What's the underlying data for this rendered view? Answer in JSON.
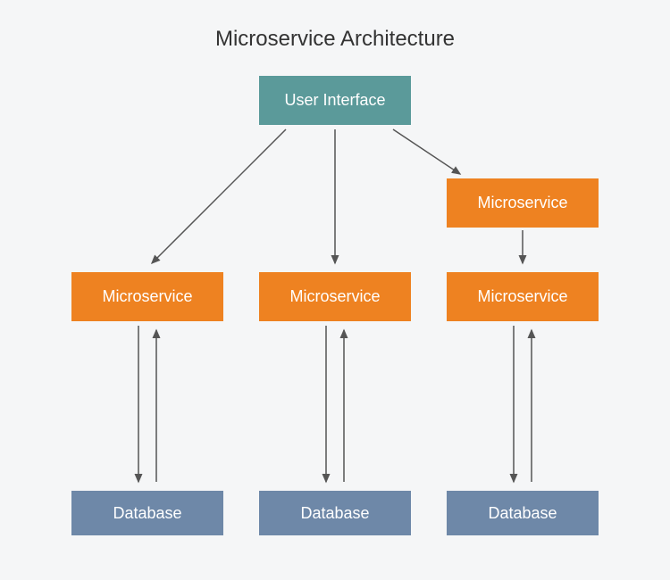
{
  "title": "Microservice Architecture",
  "nodes": {
    "ui": "User Interface",
    "ms_top": "Microservice",
    "ms1": "Microservice",
    "ms2": "Microservice",
    "ms3": "Microservice",
    "db1": "Database",
    "db2": "Database",
    "db3": "Database"
  },
  "colors": {
    "ui": "#5b9a9a",
    "microservice": "#ee8221",
    "database": "#6e88a8",
    "arrow": "#555555",
    "background": "#f5f6f7"
  }
}
